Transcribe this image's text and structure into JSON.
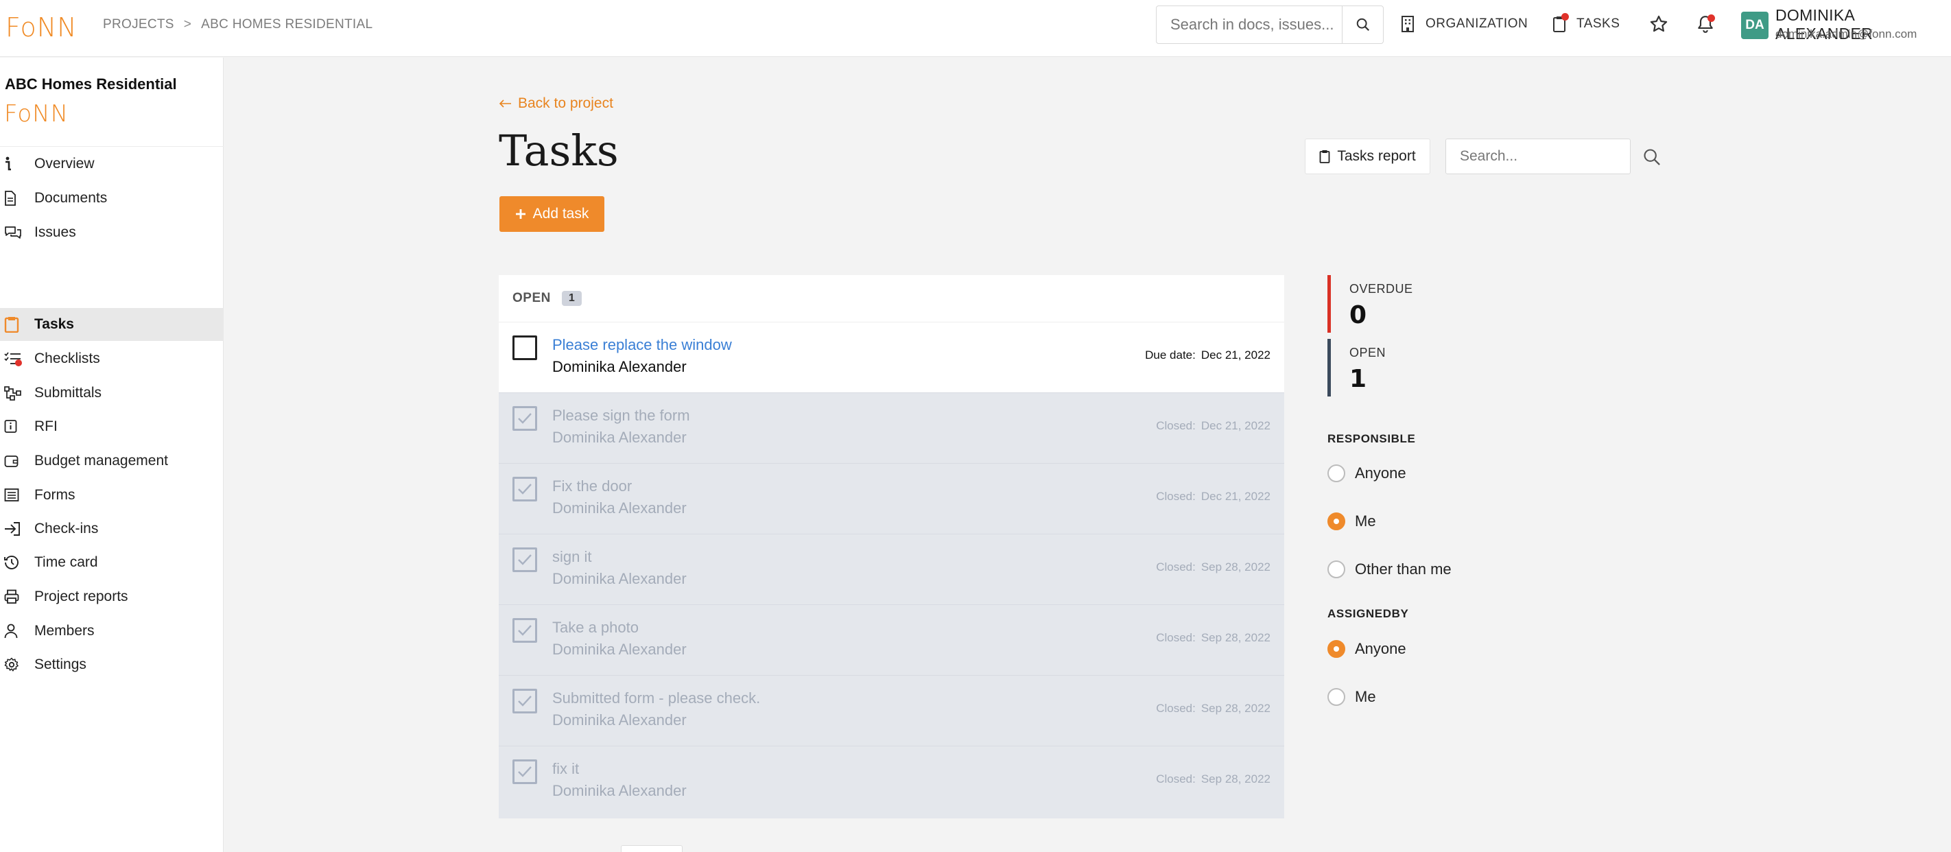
{
  "topbar": {
    "brand": "FoNN",
    "breadcrumb": [
      "PROJECTS",
      ">",
      "ABC HOMES RESIDENTIAL"
    ],
    "search_placeholder": "Search in docs, issues...",
    "organization_label": "ORGANIZATION",
    "tasks_label": "TASKS",
    "user": {
      "initials": "DA",
      "name": "DOMINIKA ALEXANDER",
      "email": "dominika.admin@fonn.com"
    }
  },
  "sidebar": {
    "project_title": "ABC Homes Residential",
    "project_logo": "FoNN",
    "items": [
      {
        "label": "Overview",
        "icon": "info-icon"
      },
      {
        "label": "Documents",
        "icon": "document-icon"
      },
      {
        "label": "Issues",
        "icon": "chat-icon"
      },
      {
        "label": "Tasks",
        "icon": "clipboard-icon",
        "active": true
      },
      {
        "label": "Checklists",
        "icon": "checklist-icon"
      },
      {
        "label": "Submittals",
        "icon": "flow-icon"
      },
      {
        "label": "RFI",
        "icon": "rfi-icon"
      },
      {
        "label": "Budget management",
        "icon": "wallet-icon"
      },
      {
        "label": "Forms",
        "icon": "form-icon"
      },
      {
        "label": "Check-ins",
        "icon": "check-in-icon"
      },
      {
        "label": "Time card",
        "icon": "history-icon"
      },
      {
        "label": "Project reports",
        "icon": "printer-icon"
      },
      {
        "label": "Members",
        "icon": "user-icon"
      },
      {
        "label": "Settings",
        "icon": "gear-icon"
      }
    ]
  },
  "main": {
    "back_label": "Back to project",
    "title": "Tasks",
    "add_task_label": "Add task",
    "tasks_report_label": "Tasks report",
    "search_placeholder": "Search...",
    "list": {
      "section_label": "OPEN",
      "count": "1",
      "tasks": [
        {
          "title": "Please replace the window",
          "assignee": "Dominika Alexander",
          "date_label": "Due date:",
          "date": "Dec 21, 2022",
          "status": "open"
        },
        {
          "title": "Please sign the form",
          "assignee": "Dominika Alexander",
          "date_label": "Closed:",
          "date": "Dec 21, 2022",
          "status": "closed"
        },
        {
          "title": "Fix the door",
          "assignee": "Dominika Alexander",
          "date_label": "Closed:",
          "date": "Dec 21, 2022",
          "status": "closed"
        },
        {
          "title": "sign it",
          "assignee": "Dominika Alexander",
          "date_label": "Closed:",
          "date": "Sep 28, 2022",
          "status": "closed"
        },
        {
          "title": "Take a photo",
          "assignee": "Dominika Alexander",
          "date_label": "Closed:",
          "date": "Sep 28, 2022",
          "status": "closed"
        },
        {
          "title": "Submitted form - please check.",
          "assignee": "Dominika Alexander",
          "date_label": "Closed:",
          "date": "Sep 28, 2022",
          "status": "closed"
        },
        {
          "title": "fix it",
          "assignee": "Dominika Alexander",
          "date_label": "Closed:",
          "date": "Sep 28, 2022",
          "status": "closed"
        }
      ]
    }
  },
  "filters": {
    "stats": [
      {
        "label": "OVERDUE",
        "value": "0",
        "color": "#d93025"
      },
      {
        "label": "OPEN",
        "value": "1",
        "color": "#3b4a5c"
      }
    ],
    "responsible": {
      "heading": "RESPONSIBLE",
      "options": [
        {
          "label": "Anyone",
          "selected": false
        },
        {
          "label": "Me",
          "selected": true
        },
        {
          "label": "Other than me",
          "selected": false
        }
      ]
    },
    "assignedby": {
      "heading": "ASSIGNEDBY",
      "options": [
        {
          "label": "Anyone",
          "selected": true
        },
        {
          "label": "Me",
          "selected": false
        }
      ]
    }
  },
  "colors": {
    "accent": "#ef8a2b",
    "link": "#3a7fd5",
    "closed_row": "#e4e7ec"
  }
}
